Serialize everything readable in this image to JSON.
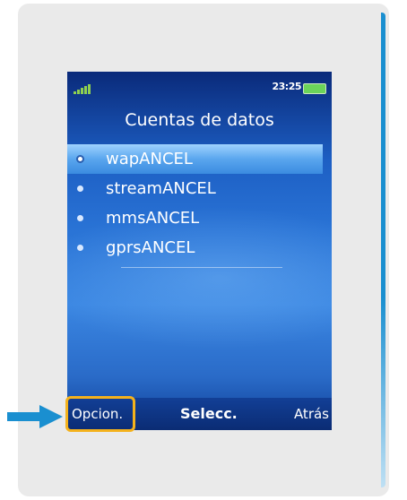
{
  "status_bar": {
    "time": "23:25",
    "signal_icon": "signal-bars-icon",
    "battery_icon": "battery-icon"
  },
  "screen": {
    "title": "Cuentas de datos",
    "items": [
      {
        "label": "wapANCEL",
        "selected": true
      },
      {
        "label": "streamANCEL",
        "selected": false
      },
      {
        "label": "mmsANCEL",
        "selected": false
      },
      {
        "label": "gprsANCEL",
        "selected": false
      }
    ]
  },
  "softkeys": {
    "left": "Opcion.",
    "center": "Selecc.",
    "right": "Atrás"
  },
  "annotation": {
    "arrow_icon": "arrow-right-icon",
    "highlight_color": "#f4b21c",
    "arrow_color": "#1a8fd0"
  },
  "colors": {
    "card_background": "#eaeaea",
    "screen_blue": "#2a74d6",
    "selected_bar": "#5aa6ee"
  }
}
